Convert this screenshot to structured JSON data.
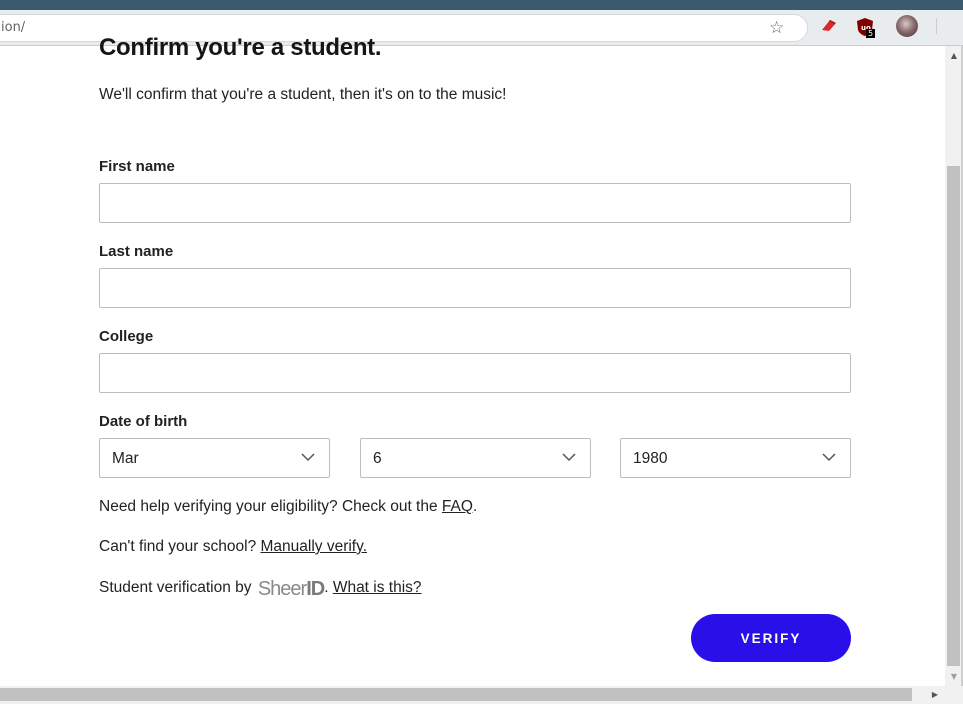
{
  "browser": {
    "url_fragment": "ion/",
    "extension_badge": "5",
    "icons": [
      "star-icon",
      "red-extension-icon",
      "ublock-icon",
      "profile-avatar"
    ]
  },
  "form": {
    "title": "Confirm you're a student.",
    "subtitle": "We'll confirm that you're a student, then it's on to the music!",
    "first_name": {
      "label": "First name",
      "value": "",
      "placeholder": ""
    },
    "last_name": {
      "label": "Last name",
      "value": "",
      "placeholder": ""
    },
    "college": {
      "label": "College",
      "value": "",
      "placeholder": ""
    },
    "dob": {
      "label": "Date of birth",
      "month": "Mar",
      "day": "6",
      "year": "1980"
    },
    "help": {
      "faq_prefix": "Need help verifying your eligibility? Check out the ",
      "faq_link": "FAQ",
      "faq_suffix": ".",
      "school_prefix": "Can't find your school? ",
      "school_link": "Manually verify.",
      "verification_prefix": "Student verification by ",
      "sheer_logo_text": "Sheer",
      "sheer_logo_id": "ID",
      "what_link": "What is this?"
    },
    "verify_label": "VERIFY"
  },
  "colors": {
    "accent": "#2a10e8",
    "text": "#222222"
  }
}
